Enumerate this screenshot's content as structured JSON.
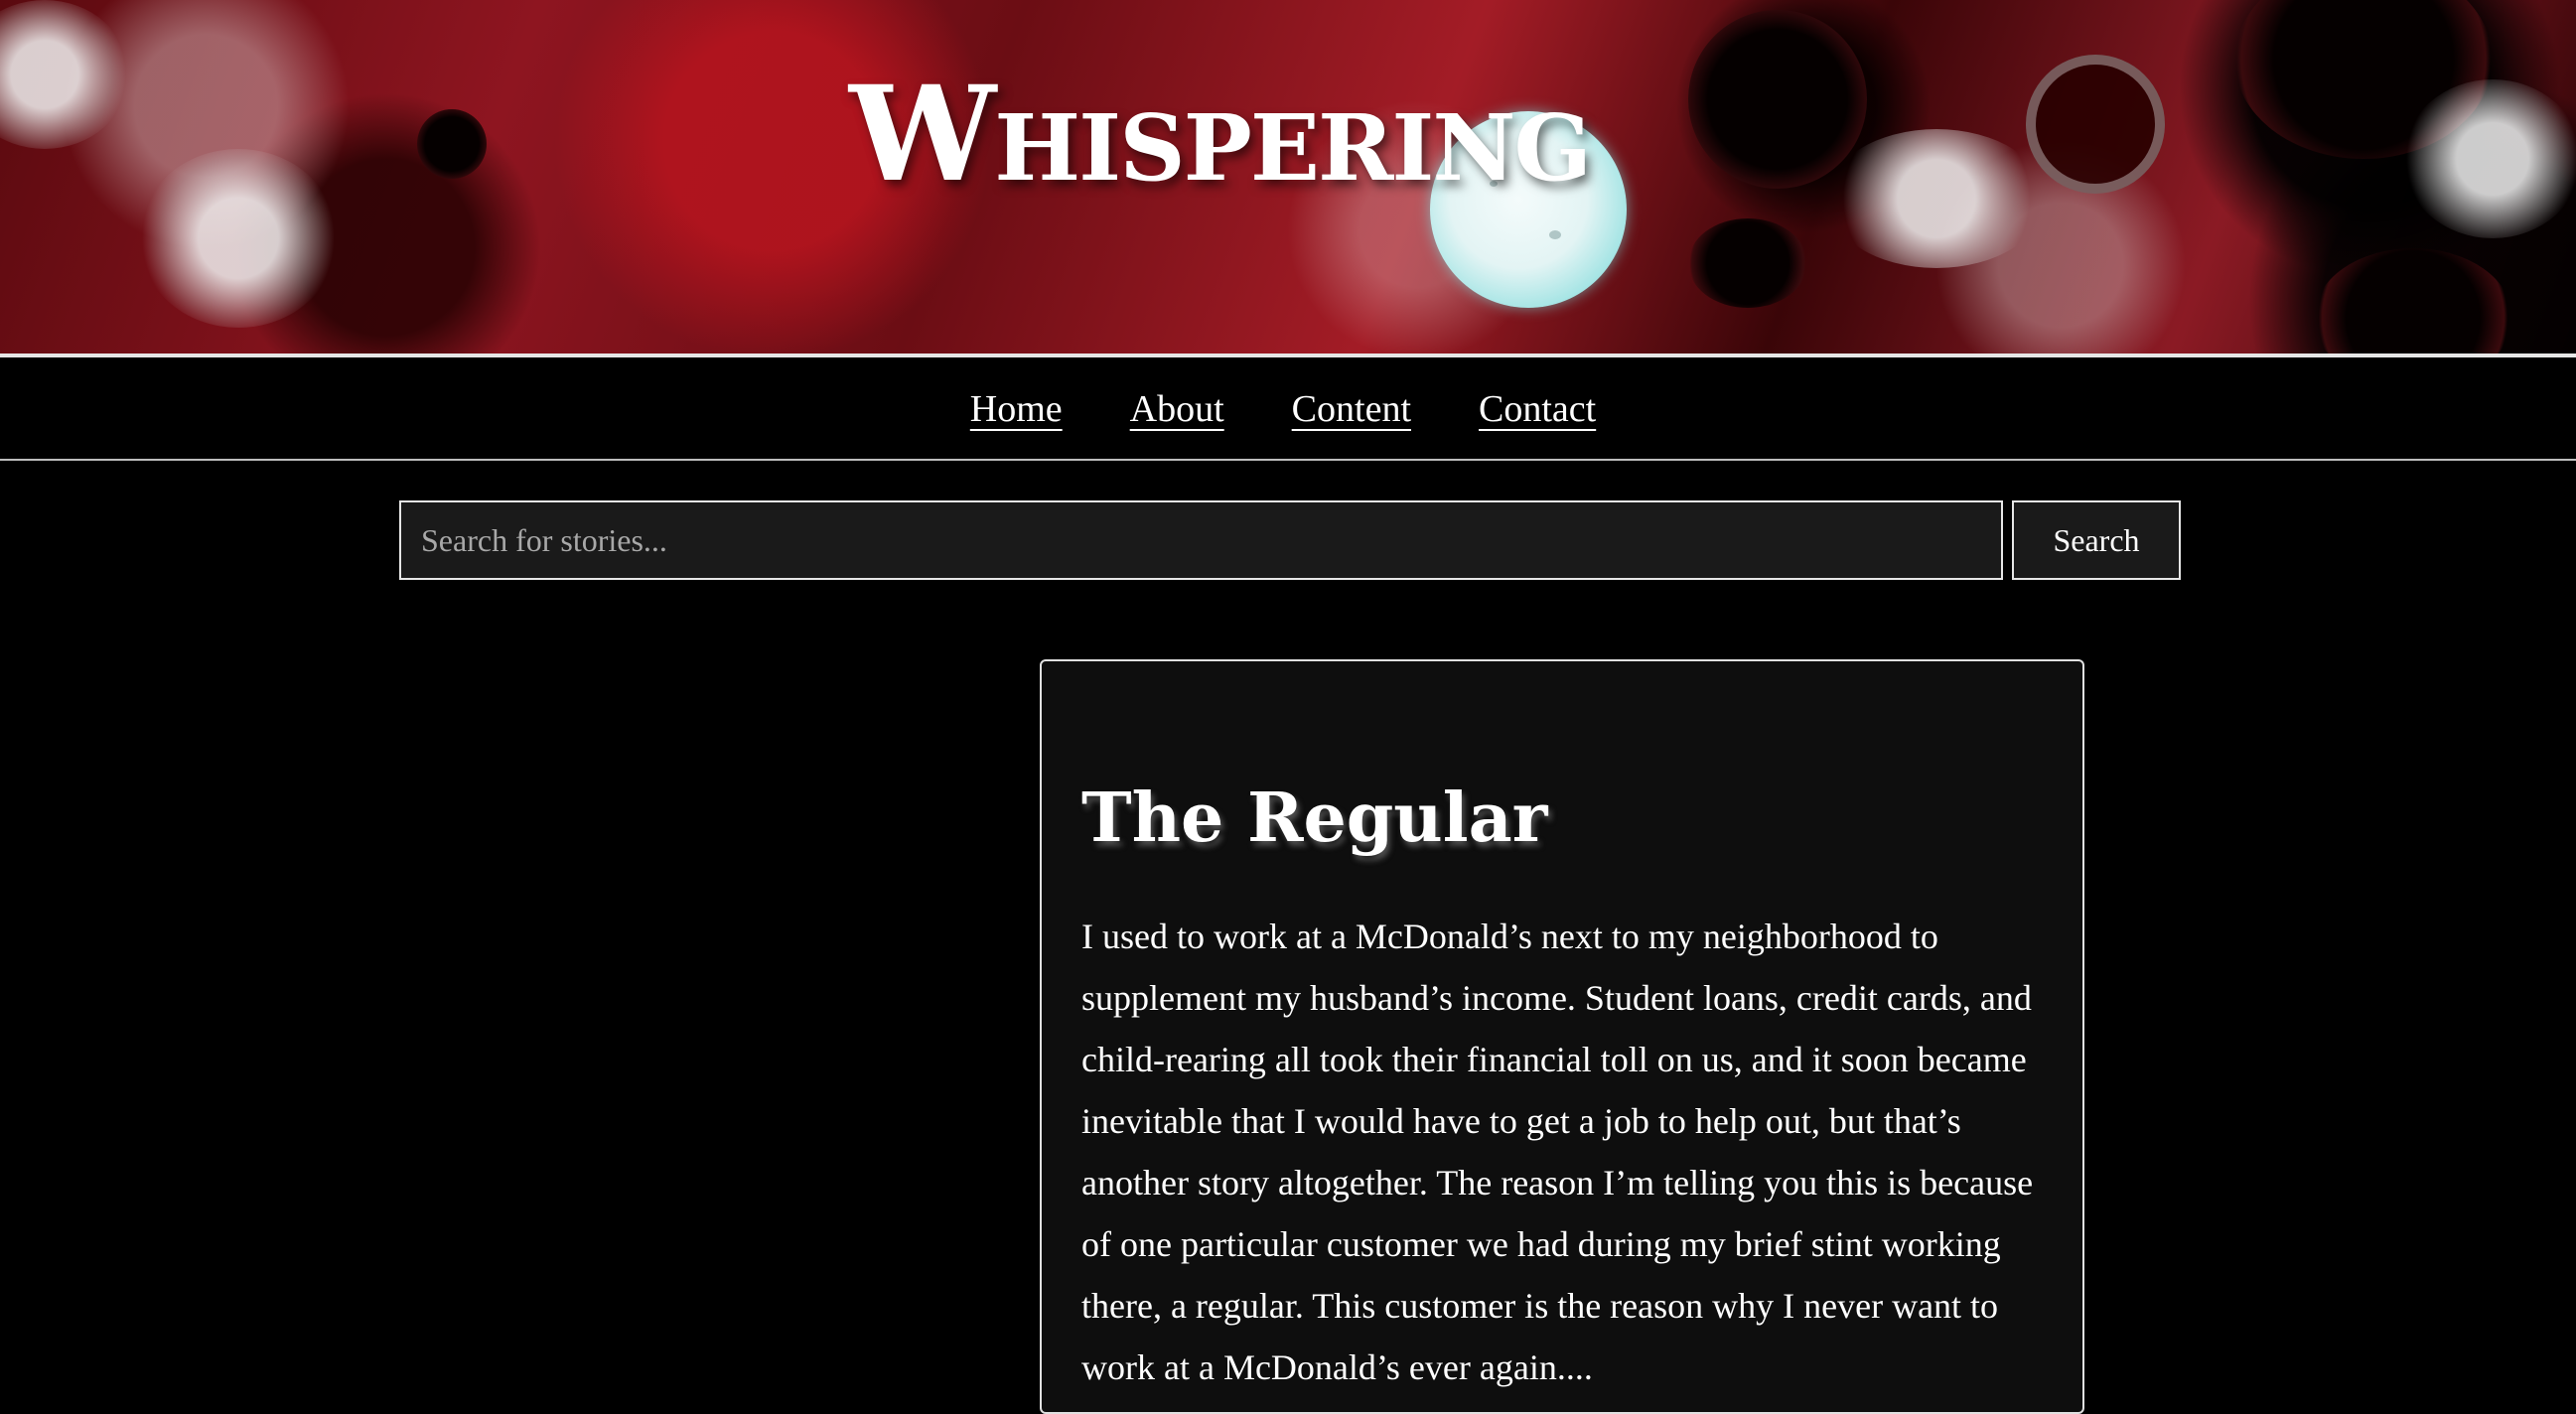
{
  "banner": {
    "logo_text": "Whispering"
  },
  "nav": {
    "items": [
      {
        "label": "Home"
      },
      {
        "label": "About"
      },
      {
        "label": "Content"
      },
      {
        "label": "Contact"
      }
    ]
  },
  "search": {
    "placeholder": "Search for stories...",
    "value": "",
    "button_label": "Search"
  },
  "story": {
    "title": "The Regular",
    "excerpt": "I used to work at a McDonald’s next to my neighborhood to supplement my husband’s income. Student loans, credit cards, and child-rearing all took their financial toll on us, and it soon became inevitable that I would have to get a job to help out, but that’s another story altogether. The reason I’m telling you this is because of one particular customer we had during my brief stint working there, a regular. This customer is the reason why I never want to work at a McDonald’s ever again...."
  },
  "colors": {
    "background": "#000000",
    "banner_red": "#8e1520",
    "moon": "#e3f4f4",
    "card_background": "#0e0e0e",
    "border": "#e6e6e6"
  }
}
